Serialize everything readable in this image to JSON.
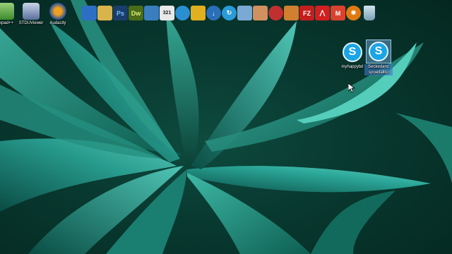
{
  "desktop": {
    "left_icons": [
      {
        "label": "tepad++",
        "icon": "notepad-plus-icon"
      },
      {
        "label": "STDUViewer",
        "icon": "stduviewer-icon"
      },
      {
        "label": "Audacity",
        "icon": "audacity-icon"
      }
    ],
    "quick_launch": [
      {
        "icon": "computer-icon",
        "text": "",
        "color": "#2d6fc4"
      },
      {
        "icon": "folder-icon",
        "text": "",
        "color": "#d9b44a"
      },
      {
        "icon": "photoshop-icon",
        "text": "Ps",
        "color": "#1b3d6e"
      },
      {
        "icon": "dreamweaver-icon",
        "text": "Dw",
        "color": "#4a6b1a"
      },
      {
        "icon": "monitor-icon",
        "text": "",
        "color": "#3a7ec0"
      },
      {
        "icon": "calendar-icon",
        "text": "321",
        "color": "#e8e8e8"
      },
      {
        "icon": "globe-icon",
        "text": "",
        "color": "#2a8fd0"
      },
      {
        "icon": "bird-mail-icon",
        "text": "",
        "color": "#e0b020"
      },
      {
        "icon": "download-icon",
        "text": "",
        "color": "#2a6fb8"
      },
      {
        "icon": "refresh-icon",
        "text": "",
        "color": "#2a9ad8"
      },
      {
        "icon": "document-icon",
        "text": "",
        "color": "#7aa9d6"
      },
      {
        "icon": "hand-icon",
        "text": "",
        "color": "#d09060"
      },
      {
        "icon": "media-icon",
        "text": "",
        "color": "#c03030"
      },
      {
        "icon": "paint-icon",
        "text": "",
        "color": "#d08030"
      },
      {
        "icon": "filezilla-icon",
        "text": "FZ",
        "color": "#c41e1e"
      },
      {
        "icon": "acrobat-icon",
        "text": "",
        "color": "#d02020"
      },
      {
        "icon": "gmail-icon",
        "text": "M",
        "color": "#d8422f"
      },
      {
        "icon": "settings-icon",
        "text": "",
        "color": "#e07a10"
      },
      {
        "icon": "recycle-bin-icon",
        "text": "",
        "color": "#8fb8cc"
      }
    ],
    "skype_icons": [
      {
        "label": "myhappybd",
        "selected": false
      },
      {
        "label": "Seckedanc spoedalbu",
        "selected": true
      }
    ]
  }
}
